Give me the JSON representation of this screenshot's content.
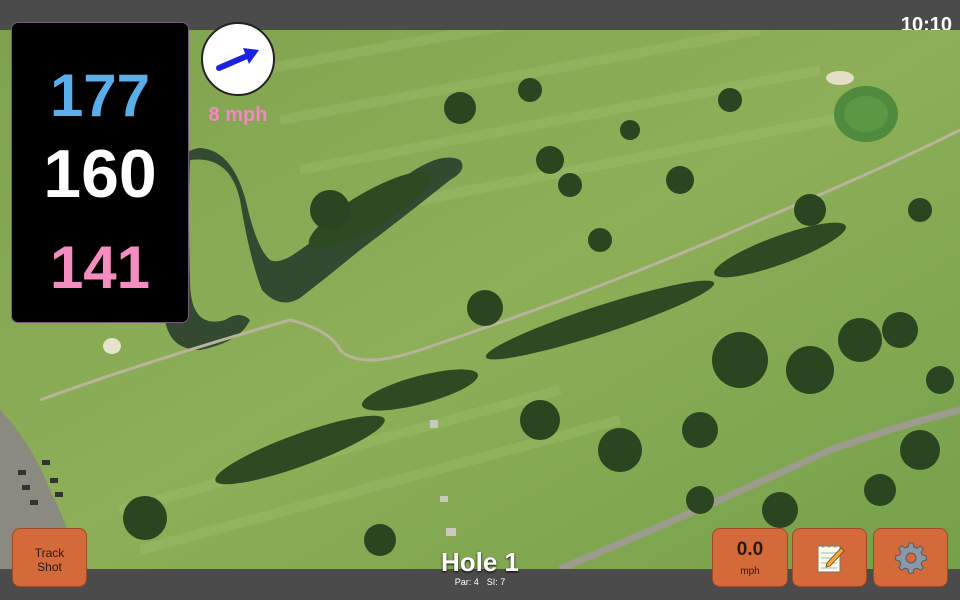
{
  "status_bar": {
    "time": "10:10"
  },
  "distances": {
    "back": "177",
    "center": "160",
    "front": "141"
  },
  "colors": {
    "back": "#5aaeea",
    "center": "#ffffff",
    "front": "#f58ec0",
    "button": "#d4693a",
    "wind_arrow": "#1a24e0"
  },
  "wind": {
    "speed": "8 mph",
    "direction_icon": "wind-arrow-icon"
  },
  "buttons": {
    "track_shot_line1": "Track",
    "track_shot_line2": "Shot",
    "speed_value": "0.0",
    "speed_unit": "mph",
    "notes_icon": "notepad-icon",
    "settings_icon": "gear-icon"
  },
  "hole": {
    "title": "Hole 1",
    "par": "Par: 4",
    "si": "SI: 7"
  },
  "map": {
    "type": "satellite",
    "content": "golf-course"
  }
}
